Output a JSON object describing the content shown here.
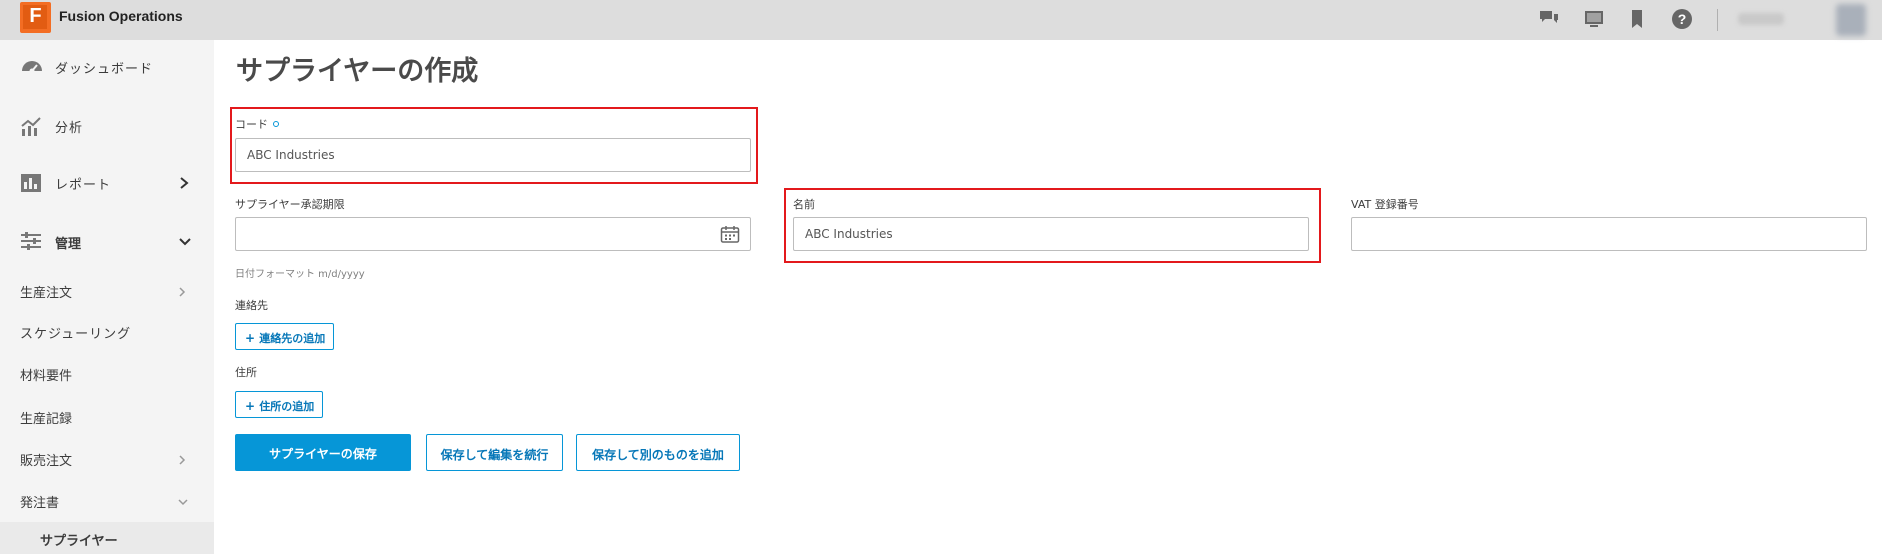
{
  "app": {
    "logo_letter": "F",
    "title": "Fusion Operations"
  },
  "topbar_icons": [
    "chat-icon",
    "monitor-icon",
    "bookmark-icon",
    "help-icon"
  ],
  "sidebar": {
    "main_items": [
      {
        "label": "ダッシュボード",
        "icon": "dashboard-icon"
      },
      {
        "label": "分析",
        "icon": "analytics-icon"
      },
      {
        "label": "レポート",
        "icon": "report-icon"
      },
      {
        "label": "管理",
        "icon": "sliders-icon"
      }
    ],
    "sub_items": [
      "生産注文",
      "スケジューリング",
      "材料要件",
      "生産記録",
      "販売注文",
      "発注書"
    ],
    "active_item": "サプライヤー"
  },
  "page": {
    "title": "サプライヤーの作成",
    "code": {
      "label": "コード",
      "value": "ABC Industries"
    },
    "approval": {
      "label": "サプライヤー承認期限",
      "value": "",
      "hint": "日付フォーマット m/d/yyyy"
    },
    "name": {
      "label": "名前",
      "value": "ABC Industries"
    },
    "vat": {
      "label": "VAT 登録番号",
      "value": ""
    },
    "contacts": {
      "label": "連絡先",
      "add_button": "連絡先の追加"
    },
    "address": {
      "label": "住所",
      "add_button": "住所の追加"
    },
    "buttons": {
      "save": "サプライヤーの保存",
      "save_continue": "保存して編集を続行",
      "save_add": "保存して別のものを追加"
    }
  },
  "colors": {
    "accent": "#0696d7",
    "highlight": "#e3191c",
    "brand": "#f36d23"
  }
}
